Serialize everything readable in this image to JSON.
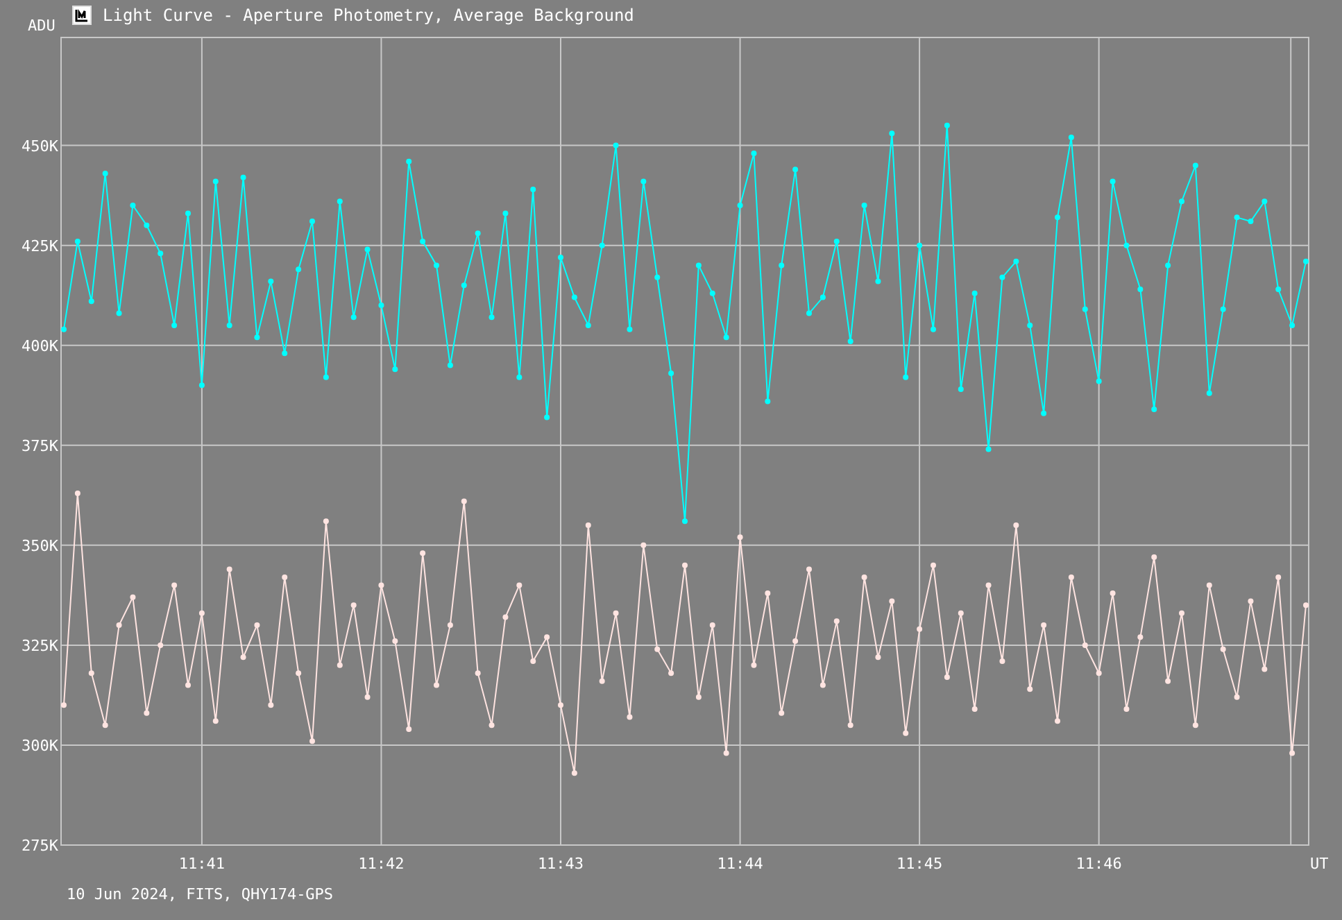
{
  "window": {
    "title": "Light Curve - Aperture Photometry, Average Background"
  },
  "plot": {
    "chart_data": {
      "type": "line",
      "ylabel": "ADU",
      "xlabel": "UT",
      "ylim": [
        275,
        477
      ],
      "yticks": [
        {
          "value": 450,
          "label": "450K"
        },
        {
          "value": 425,
          "label": "425K"
        },
        {
          "value": 400,
          "label": "400K"
        },
        {
          "value": 375,
          "label": "375K"
        },
        {
          "value": 350,
          "label": "350K"
        },
        {
          "value": 325,
          "label": "325K"
        },
        {
          "value": 300,
          "label": "300K"
        },
        {
          "value": 275,
          "label": "275K"
        }
      ],
      "grid": true,
      "categories": [
        null,
        null,
        null,
        null,
        null,
        null,
        null,
        null,
        null,
        null,
        "11:41",
        null,
        null,
        null,
        null,
        null,
        null,
        null,
        null,
        null,
        null,
        null,
        null,
        "11:42",
        null,
        null,
        null,
        null,
        null,
        null,
        null,
        null,
        null,
        null,
        null,
        null,
        "11:43",
        null,
        null,
        null,
        null,
        null,
        null,
        null,
        null,
        null,
        null,
        null,
        null,
        "11:44",
        null,
        null,
        null,
        null,
        null,
        null,
        null,
        null,
        null,
        null,
        null,
        null,
        "11:45",
        null,
        null,
        null,
        null,
        null,
        null,
        null,
        null,
        null,
        null,
        null,
        null,
        "11:46",
        null,
        null,
        null,
        null,
        null,
        null,
        null,
        null,
        null,
        null,
        null,
        null,
        null,
        null,
        null
      ],
      "series": [
        {
          "color": "#00ffff",
          "marker": "circle",
          "values": [
            404,
            426,
            411,
            443,
            408,
            435,
            430,
            423,
            405,
            433,
            390,
            441,
            405,
            442,
            402,
            416,
            398,
            419,
            431,
            392,
            436,
            407,
            424,
            410,
            394,
            446,
            426,
            420,
            395,
            415,
            428,
            407,
            433,
            392,
            439,
            382,
            422,
            412,
            405,
            425,
            450,
            404,
            441,
            417,
            393,
            356,
            420,
            413,
            402,
            435,
            448,
            386,
            420,
            444,
            408,
            412,
            426,
            401,
            435,
            416,
            453,
            392,
            425,
            404,
            455,
            389,
            413,
            374,
            417,
            421,
            405,
            383,
            432,
            452,
            409,
            391,
            441,
            425,
            414,
            384,
            420,
            436,
            445,
            388,
            409,
            432,
            431,
            436,
            414,
            405,
            421
          ]
        },
        {
          "color": "#ffe4e1",
          "marker": "circle",
          "values": [
            310,
            363,
            318,
            305,
            330,
            337,
            308,
            325,
            340,
            315,
            333,
            306,
            344,
            322,
            330,
            310,
            342,
            318,
            301,
            356,
            320,
            335,
            312,
            340,
            326,
            304,
            348,
            315,
            330,
            361,
            318,
            305,
            332,
            340,
            321,
            327,
            310,
            293,
            355,
            316,
            333,
            307,
            350,
            324,
            318,
            345,
            312,
            330,
            298,
            352,
            320,
            338,
            308,
            326,
            344,
            315,
            331,
            305,
            342,
            322,
            336,
            303,
            329,
            345,
            317,
            333,
            309,
            340,
            321,
            355,
            314,
            330,
            306,
            342,
            325,
            318,
            338,
            309,
            327,
            347,
            316,
            333,
            305,
            340,
            324,
            312,
            336,
            319,
            342,
            298,
            335
          ]
        }
      ]
    }
  },
  "footer": "10 Jun 2024, FITS, QHY174-GPS"
}
